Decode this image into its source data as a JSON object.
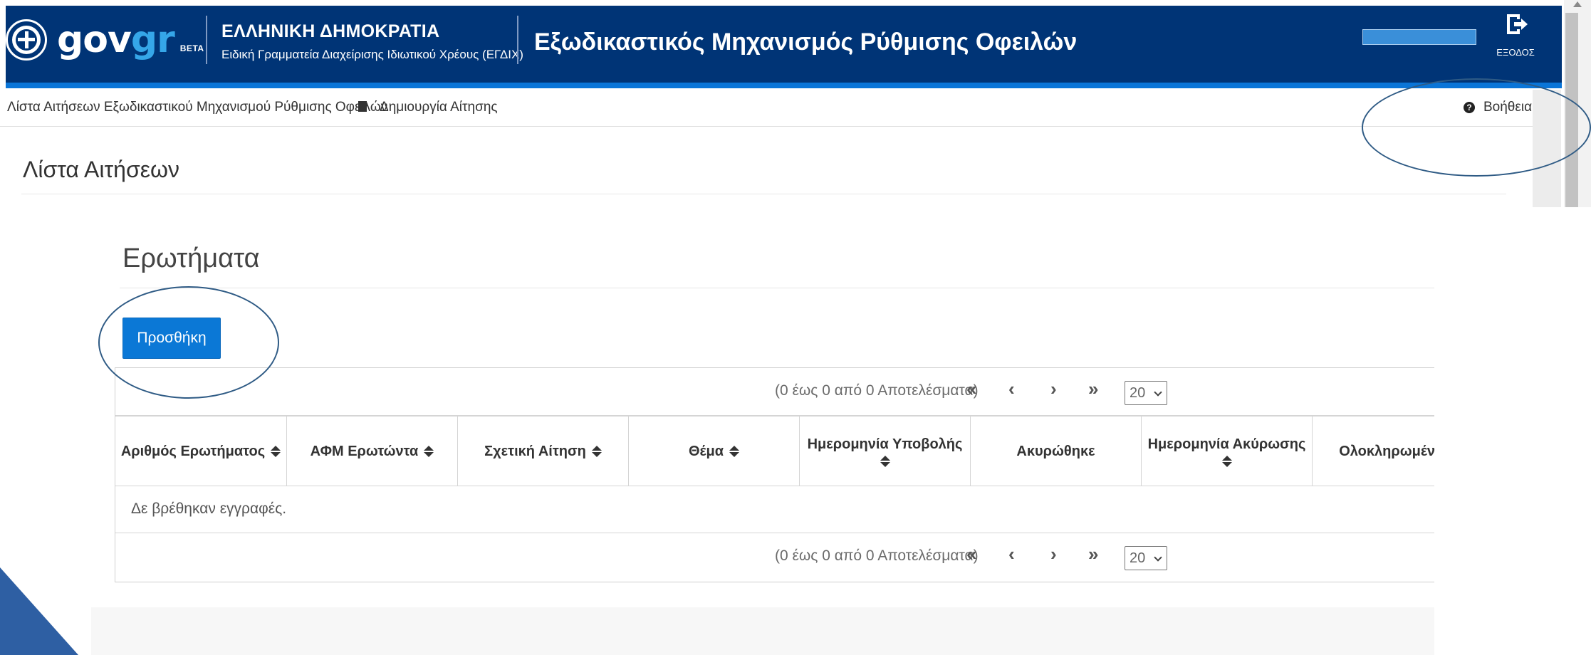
{
  "header": {
    "brand_gov": "gov",
    "brand_gr": "gr",
    "beta": "BETA",
    "ministry_title": "ΕΛΛΗΝΙΚΗ ΔΗΜΟΚΡΑΤΙΑ",
    "ministry_subtitle": "Ειδική Γραμματεία Διαχείρισης Ιδιωτικού Χρέους (ΕΓΔΙΧ)",
    "app_title": "Εξωδικαστικός Μηχανισμός Ρύθμισης Οφειλών",
    "logout_label": "ΕΞΟΔΟΣ"
  },
  "nav": {
    "list_link": "Λίστα Αιτήσεων Εξωδικαστικού Μηχανισμού Ρύθμισης Οφειλών",
    "create_link": "Δημιουργία Αίτησης",
    "help_label": "Βοήθεια"
  },
  "page": {
    "title": "Λίστα Αιτήσεων"
  },
  "questions": {
    "title": "Ερωτήματα",
    "add_button": "Προσθήκη",
    "pager": {
      "results": "(0 έως 0 από 0 Αποτελέσματα)",
      "first": "«",
      "prev": "‹",
      "next": "›",
      "last": "»",
      "page_size": "20"
    },
    "columns": [
      "Αριθμός Ερωτήματος",
      "ΑΦΜ Ερωτώντα",
      "Σχετική Αίτηση",
      "Θέμα",
      "Ημερομηνία Υποβολής",
      "Ακυρώθηκε",
      "Ημερομηνία Ακύρωσης",
      "Ολοκληρωμέν"
    ],
    "empty_message": "Δε βρέθηκαν εγγραφές."
  },
  "colors": {
    "header_bg": "#003476",
    "accent": "#0a75d8",
    "button": "#0b78d6",
    "annotation": "#2f5b85"
  }
}
